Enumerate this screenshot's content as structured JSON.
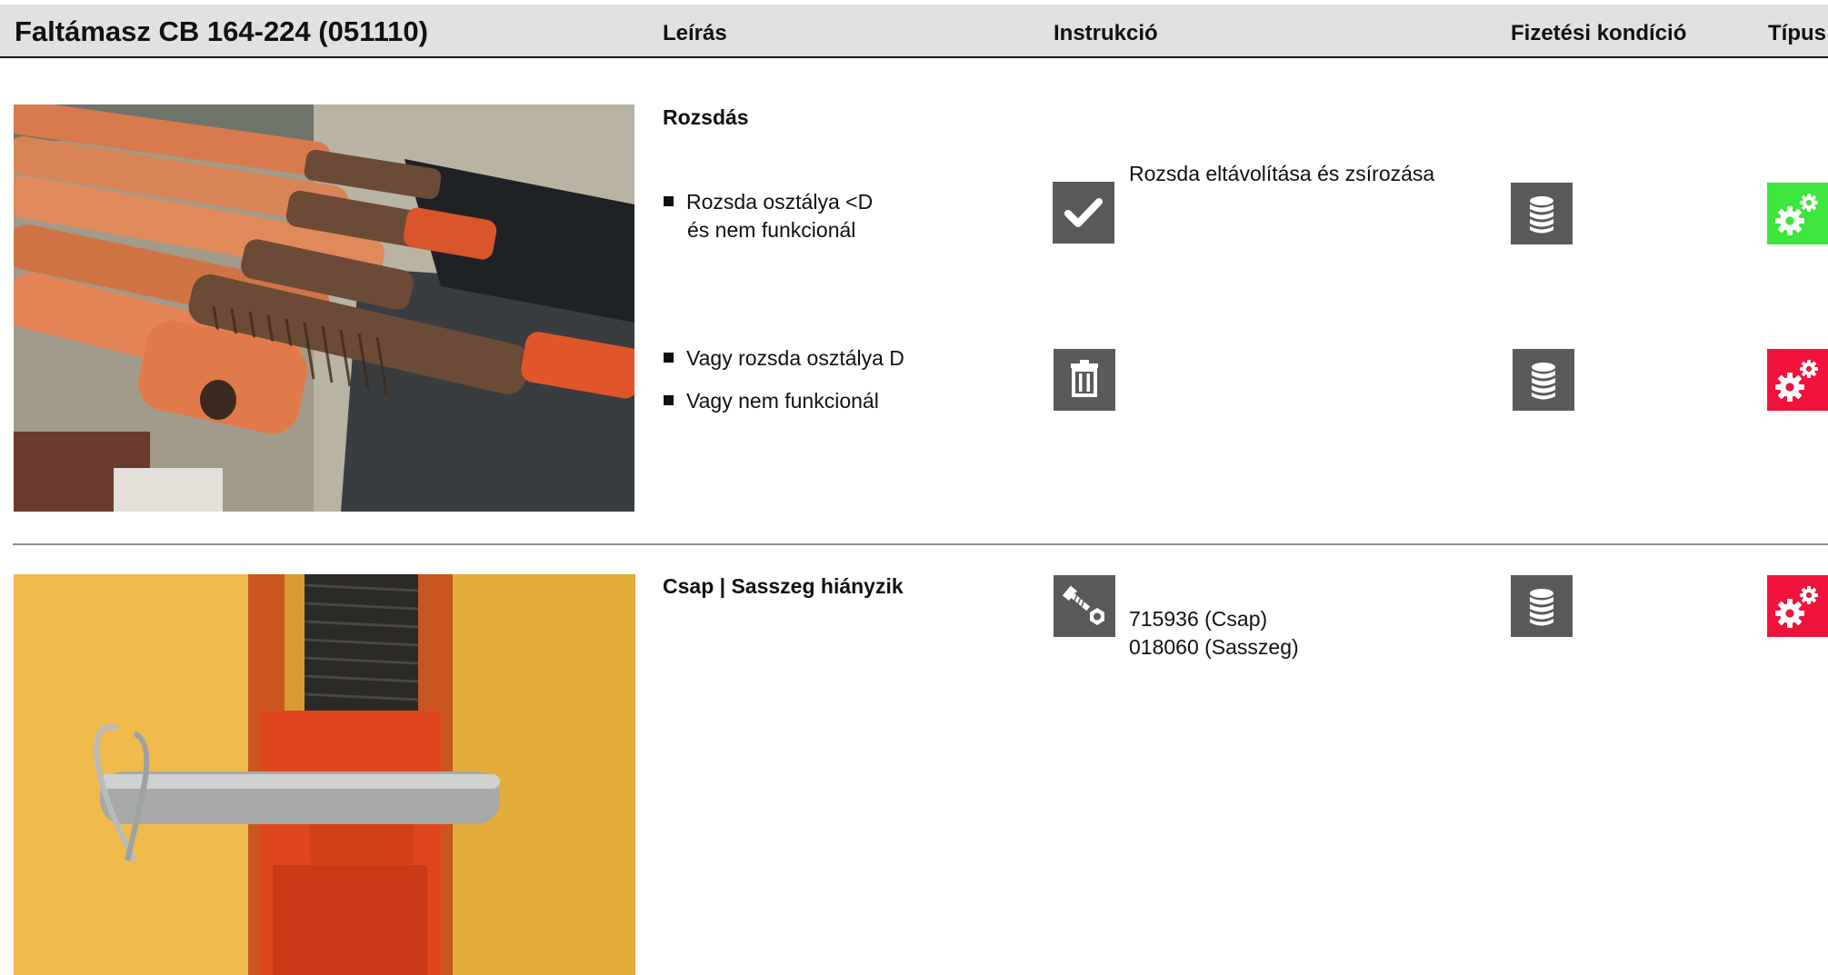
{
  "header": {
    "title": "Faltámasz CB 164-224 (051110)",
    "col_description": "Leírás",
    "col_instruction": "Instrukció",
    "col_payment": "Fizetési kondíció",
    "col_type": "Típus"
  },
  "sections": [
    {
      "heading": "Rozsdás",
      "cases": [
        {
          "lines": [
            "Rozsda osztálya <D",
            "és nem funkcionál"
          ],
          "instruction_icon": "check-icon",
          "instruction_text": "Rozsda eltávolítása és zsírozása",
          "payment_icon": "coin-stack-icon",
          "type_icon": "gears-icon",
          "type_color": "#3ce63c"
        },
        {
          "lines": [
            "Vagy rozsda osztálya D",
            "Vagy nem funkcionál"
          ],
          "instruction_icon": "trash-icon",
          "payment_icon": "coin-stack-icon",
          "type_icon": "gears-icon",
          "type_color": "#f0143c"
        }
      ]
    },
    {
      "heading": "Csap | Sasszeg hiányzik",
      "cases": [
        {
          "instruction_icon": "bolt-nut-icon",
          "instruction_lines": [
            "715936 (Csap)",
            "018060 (Sasszeg)"
          ],
          "payment_icon": "coin-stack-icon",
          "type_icon": "gears-icon",
          "type_color": "#f0143c"
        }
      ]
    }
  ],
  "colors": {
    "header_bg": "#e1e1e1",
    "icon_box": "#5a5a5a",
    "type_ok": "#3ce63c",
    "type_bad": "#f0143c"
  }
}
